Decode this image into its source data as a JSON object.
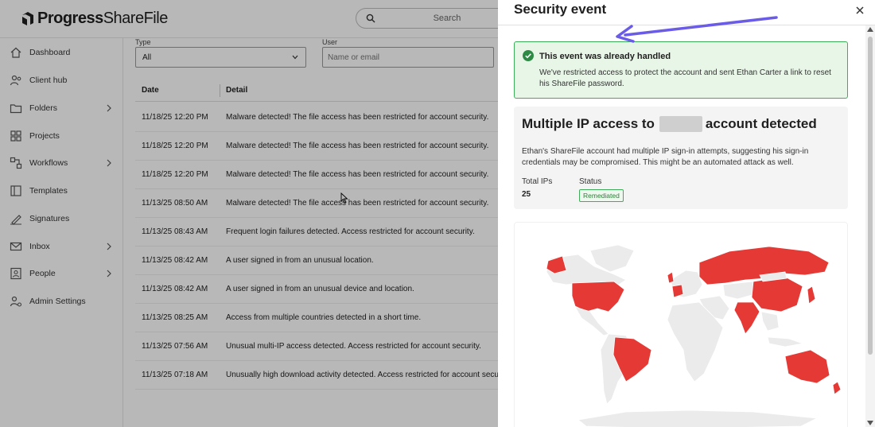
{
  "app": {
    "brand_strong": "Progress",
    "brand_light": "ShareFile",
    "search_placeholder": "Search"
  },
  "sidebar": {
    "items": [
      {
        "label": "Dashboard",
        "icon": "home-icon",
        "chevron": false
      },
      {
        "label": "Client hub",
        "icon": "client-hub-icon",
        "chevron": false
      },
      {
        "label": "Folders",
        "icon": "folder-icon",
        "chevron": true
      },
      {
        "label": "Projects",
        "icon": "projects-icon",
        "chevron": false
      },
      {
        "label": "Workflows",
        "icon": "workflows-icon",
        "chevron": true
      },
      {
        "label": "Templates",
        "icon": "templates-icon",
        "chevron": false
      },
      {
        "label": "Signatures",
        "icon": "signature-icon",
        "chevron": false
      },
      {
        "label": "Inbox",
        "icon": "inbox-icon",
        "chevron": true
      },
      {
        "label": "People",
        "icon": "people-icon",
        "chevron": true
      },
      {
        "label": "Admin Settings",
        "icon": "admin-settings-icon",
        "chevron": false
      }
    ]
  },
  "filters": {
    "type_label": "Type",
    "type_value": "All",
    "user_label": "User",
    "user_placeholder": "Name or email"
  },
  "table": {
    "col_date": "Date",
    "col_detail": "Detail",
    "rows": [
      {
        "date": "11/18/25 12:20 PM",
        "detail": "Malware detected! The file access has been restricted for account security."
      },
      {
        "date": "11/18/25 12:20 PM",
        "detail": "Malware detected! The file access has been restricted for account security."
      },
      {
        "date": "11/18/25 12:20 PM",
        "detail": "Malware detected! The file access has been restricted for account security."
      },
      {
        "date": "11/13/25 08:50 AM",
        "detail": "Malware detected! The file access has been restricted for account security."
      },
      {
        "date": "11/13/25 08:43 AM",
        "detail": "Frequent login failures detected. Access restricted for account security."
      },
      {
        "date": "11/13/25 08:42 AM",
        "detail": "A user signed in from an unusual location."
      },
      {
        "date": "11/13/25 08:42 AM",
        "detail": "A user signed in from an unusual device and location."
      },
      {
        "date": "11/13/25 08:25 AM",
        "detail": "Access from multiple countries detected in a short time."
      },
      {
        "date": "11/13/25 07:56 AM",
        "detail": "Unusual multi-IP access detected. Access restricted for account security."
      },
      {
        "date": "11/13/25 07:18 AM",
        "detail": "Unusually high download activity detected. Access restricted for account security."
      }
    ]
  },
  "drawer": {
    "title": "Security event",
    "alert_title": "This event was already handled",
    "alert_text": "We've restricted access to protect the account and sent Ethan Carter a link to reset his ShareFile password.",
    "headline_pre": "Multiple IP access to",
    "headline_post": "account detected",
    "description": "Ethan's ShareFile account had multiple IP sign-in attempts, suggesting his sign-in credentials may be compromised. This might be an automated attack as well.",
    "total_ips_label": "Total IPs",
    "total_ips_value": "25",
    "status_label": "Status",
    "status_value": "Remediated"
  },
  "colors": {
    "highlight_country": "#e53935",
    "other_country": "#ebebeb",
    "alert_border": "#3fae5a",
    "alert_bg": "#e8f6e7",
    "annotation_arrow": "#6b5ce7"
  }
}
